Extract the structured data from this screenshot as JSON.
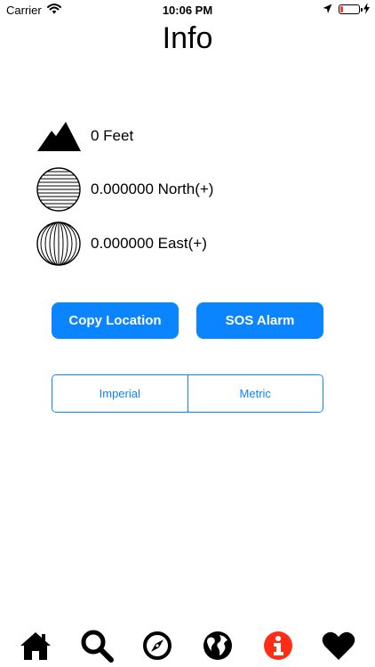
{
  "status_bar": {
    "carrier": "Carrier",
    "time": "10:06 PM"
  },
  "header": {
    "title": "Info"
  },
  "info": {
    "altitude": "0 Feet",
    "latitude": "0.000000 North(+)",
    "longitude": "0.000000 East(+)"
  },
  "actions": {
    "copy_label": "Copy Location",
    "sos_label": "SOS Alarm"
  },
  "units": {
    "options": [
      "Imperial",
      "Metric"
    ]
  },
  "tab_bar": {
    "items": [
      "home-icon",
      "search-icon",
      "compass-icon",
      "globe-icon",
      "info-icon",
      "heart-icon"
    ],
    "active": "info-icon"
  },
  "colors": {
    "accent": "#0a84ff",
    "active_tab": "#ff2d16",
    "battery_low": "#ff3b30"
  }
}
